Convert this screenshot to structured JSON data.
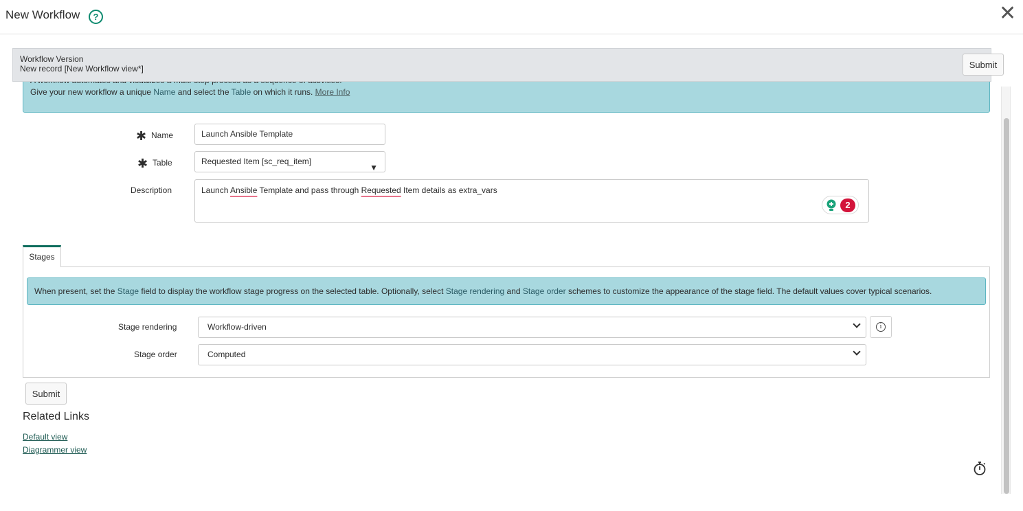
{
  "modal": {
    "title": "New Workflow",
    "help_icon": "question-circle-icon",
    "close_icon": "close-x-icon"
  },
  "record_header": {
    "label": "Workflow Version",
    "subtitle": "New record [New Workflow view*]",
    "submit_label": "Submit"
  },
  "intro_info": {
    "line1": "A workflow automates and visualizes a multi-step process as a sequence of activities.",
    "line2_prefix": "Give your new workflow a unique ",
    "line2_field1": "Name",
    "line2_mid": " and select the ",
    "line2_field2": "Table",
    "line2_suffix": " on which it runs. ",
    "more_info_link": "More Info"
  },
  "form": {
    "name": {
      "label": "Name",
      "required": true,
      "value": "Launch Ansible Template"
    },
    "table": {
      "label": "Table",
      "required": true,
      "value": "Requested Item [sc_req_item]"
    },
    "description": {
      "label": "Description",
      "value_parts": [
        "Launch ",
        "Ansible",
        " Template and pass through ",
        "Requested",
        " Item details as extra_vars"
      ],
      "spellcheck_flags": [
        "Ansible",
        "Requested"
      ],
      "assist_badge_count": "2"
    }
  },
  "tabs": [
    {
      "label": "Stages",
      "active": true
    }
  ],
  "stages": {
    "info_prefix": "When present, set the ",
    "info_field1": "Stage",
    "info_mid1": " field to display the workflow stage progress on the selected table. Optionally, select ",
    "info_field2": "Stage rendering",
    "info_mid2": " and ",
    "info_field3": "Stage order",
    "info_suffix": " schemes to customize the appearance of the stage field. The default values cover typical scenarios.",
    "stage_rendering": {
      "label": "Stage rendering",
      "value": "Workflow-driven"
    },
    "stage_order": {
      "label": "Stage order",
      "value": "Computed"
    }
  },
  "bottom": {
    "submit_label": "Submit",
    "related_links_title": "Related Links",
    "links": [
      "Default view",
      "Diagrammer view"
    ]
  },
  "colors": {
    "accent_teal": "#0d8a6f",
    "info_bg": "#a8d8df",
    "badge_red": "#d3143b",
    "tab_active": "#0e6d5d"
  }
}
